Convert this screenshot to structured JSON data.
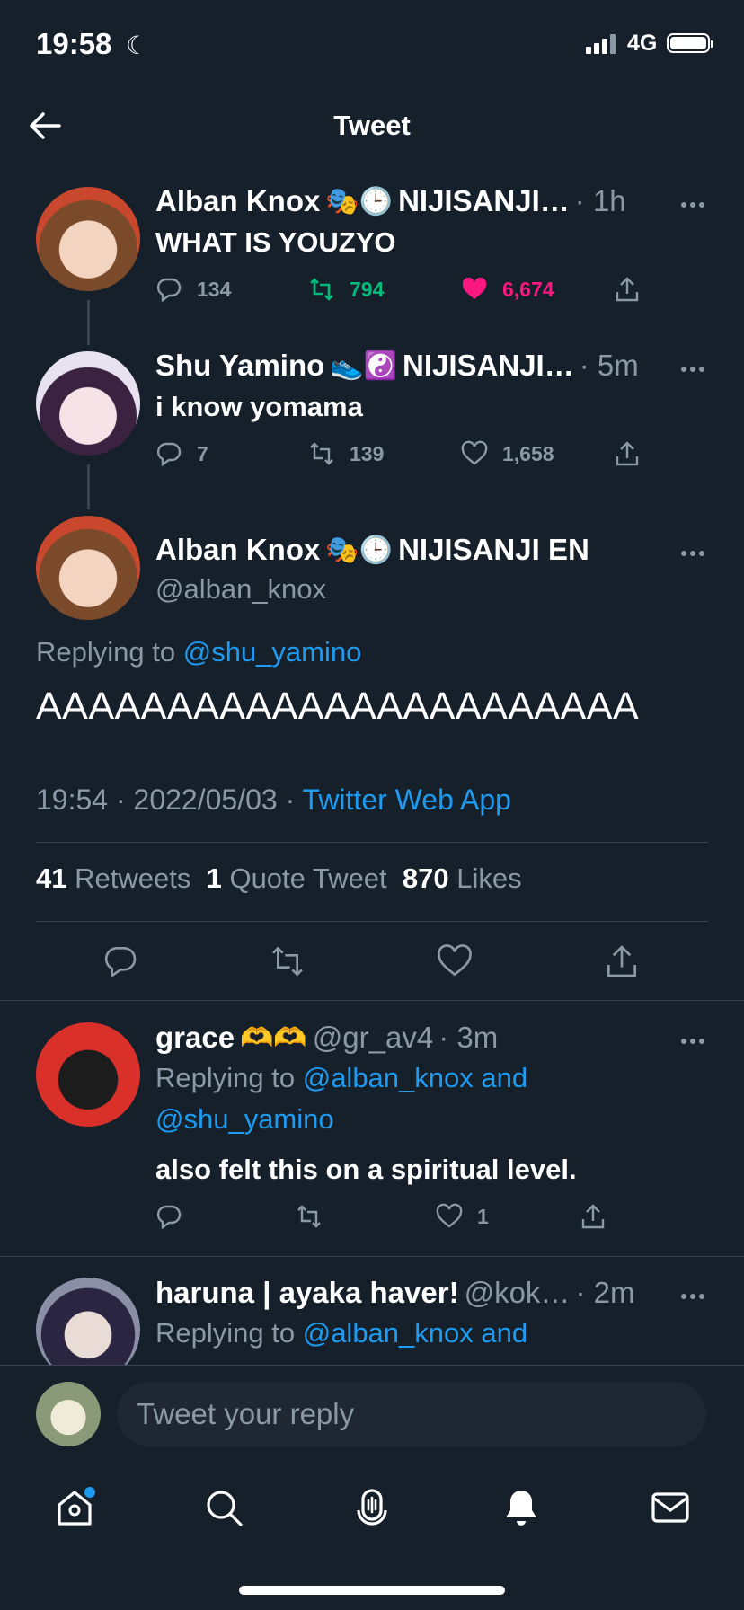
{
  "status": {
    "time": "19:58",
    "network": "4G"
  },
  "header": {
    "title": "Tweet"
  },
  "thread": [
    {
      "name": "Alban Knox",
      "emojis": "🎭🕒",
      "group": "NIJISANJI…",
      "time": "· 1h",
      "text": "WHAT IS YOUZYO",
      "replies": "134",
      "retweets": "794",
      "likes": "6,674",
      "liked": true,
      "retweeted": true
    },
    {
      "name": "Shu Yamino",
      "emojis": "👟☯️",
      "group": "NIJISANJI…",
      "time": "· 5m",
      "text": "i know yomama",
      "replies": "7",
      "retweets": "139",
      "likes": "1,658",
      "liked": false,
      "retweeted": false
    }
  ],
  "main_tweet": {
    "name": "Alban Knox",
    "emojis": "🎭🕒",
    "group": "NIJISANJI EN",
    "handle": "@alban_knox",
    "replying_prefix": "Replying to",
    "replying_to": "@shu_yamino",
    "text": "AAAAAAAAAAAAAAAAAAAAAAA",
    "time": "19:54",
    "date": "2022/05/03",
    "source": "Twitter Web App",
    "retweets_count": "41",
    "retweets_label": "Retweets",
    "quote_count": "1",
    "quote_label": "Quote Tweet",
    "likes_count": "870",
    "likes_label": "Likes"
  },
  "replies": [
    {
      "name": "grace",
      "emojis": "🫶🫶",
      "handle": "@gr_av4",
      "time": "· 3m",
      "replying_prefix": "Replying to",
      "replying_line1": "@alban_knox and",
      "replying_line2": "@shu_yamino",
      "text": "also felt this on a spiritual level.",
      "likes": "1"
    },
    {
      "name": "haruna | ayaka haver!",
      "handle": "@kok…",
      "time": "· 2m",
      "replying_prefix": "Replying to",
      "replying_line1": "@alban_knox and"
    }
  ],
  "reply_box": {
    "placeholder": "Tweet your reply"
  },
  "colors": {
    "background": "#15202b",
    "accent": "#1d9bf0",
    "like": "#f91880",
    "retweet": "#00ba7c",
    "muted": "#8b98a5"
  }
}
